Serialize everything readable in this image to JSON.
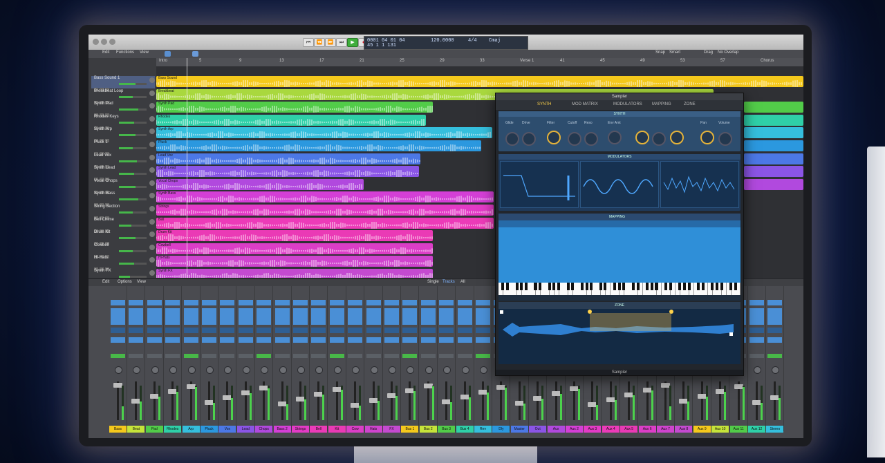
{
  "app": {
    "window_title": "Sampler",
    "plugin_footer": "Sampler"
  },
  "toolbar": {
    "transport": [
      "⏮",
      "⏪",
      "⏩",
      "⏭",
      "▶",
      "●",
      "⟲"
    ],
    "lcd": {
      "position": "0001 04 01 04",
      "bar_beat": "45  1  1  131",
      "tempo": "120.0000",
      "time_sig": "4/4",
      "key": "Cmaj"
    }
  },
  "controlbar": {
    "items": [
      "Edit",
      "Functions",
      "View"
    ],
    "right_items": [
      "Snap",
      "Smart",
      "Drag",
      "No Overlap"
    ]
  },
  "ruler": {
    "marks": [
      "Intro",
      "5",
      "9",
      "13",
      "17",
      "21",
      "25",
      "29",
      "33",
      "Verse 1",
      "41",
      "45",
      "49",
      "53",
      "57",
      "Chorus"
    ]
  },
  "tracks": [
    {
      "name": "Bass Sound 1",
      "color": "#ffd21f",
      "level": 0.6
    },
    {
      "name": "Breakbeat Loop",
      "color": "#c6e43a",
      "level": 0.5
    },
    {
      "name": "Synth Pad",
      "color": "#5ad04a",
      "level": 0.7
    },
    {
      "name": "Rhodes Keys",
      "color": "#2fd9b3",
      "level": 0.55
    },
    {
      "name": "Synth Arp",
      "color": "#35c3df",
      "level": 0.6
    },
    {
      "name": "Pluck 1",
      "color": "#2b9be0",
      "level": 0.5
    },
    {
      "name": "Lead Vox",
      "color": "#4a7de8",
      "level": 0.65
    },
    {
      "name": "Synth Lead",
      "color": "#8a56e8",
      "level": 0.55
    },
    {
      "name": "Vocal Chops",
      "color": "#b34be0",
      "level": 0.6
    },
    {
      "name": "Synth Bass",
      "color": "#d640d6",
      "level": 0.7
    },
    {
      "name": "String Section",
      "color": "#e53cc8",
      "level": 0.5
    },
    {
      "name": "Bell Chime",
      "color": "#ee3cb8",
      "level": 0.45
    },
    {
      "name": "Drum Kit",
      "color": "#ee3cb8",
      "level": 0.6
    },
    {
      "name": "Cowbell",
      "color": "#dd3fc9",
      "level": 0.5
    },
    {
      "name": "Hi-Hats",
      "color": "#d045cf",
      "level": 0.55
    },
    {
      "name": "Synth FX",
      "color": "#c64bd0",
      "level": 0.4
    }
  ],
  "regions": [
    {
      "track": 0,
      "name": "Bass Sound",
      "color": "#f5c91c"
    },
    {
      "track": 1,
      "name": "Breakbeat",
      "color": "#a9d83e"
    },
    {
      "track": 2,
      "name": "Synth Pad",
      "color": "#52cc49"
    },
    {
      "track": 3,
      "name": "Rhodes",
      "color": "#2fd0a8"
    },
    {
      "track": 4,
      "name": "Synth Arp",
      "color": "#35bfdd"
    },
    {
      "track": 5,
      "name": "Pluck",
      "color": "#2b98df"
    },
    {
      "track": 6,
      "name": "Lead Vox",
      "color": "#4c78e6"
    },
    {
      "track": 7,
      "name": "Synth Lead",
      "color": "#8b55e6"
    },
    {
      "track": 8,
      "name": "Vocal Chops",
      "color": "#b149de"
    },
    {
      "track": 9,
      "name": "Synth Bass",
      "color": "#d43fd6"
    },
    {
      "track": 10,
      "name": "Strings",
      "color": "#e33bc6"
    },
    {
      "track": 11,
      "name": "Bell",
      "color": "#ec3bb8"
    },
    {
      "track": 12,
      "name": "Drum Kit",
      "color": "#ea3ab5"
    },
    {
      "track": 13,
      "name": "Cowbell",
      "color": "#dc3ec7"
    },
    {
      "track": 14,
      "name": "Hi-Hats",
      "color": "#cf44ce"
    },
    {
      "track": 15,
      "name": "Synth FX",
      "color": "#c44ad0"
    }
  ],
  "mixer": {
    "bar": [
      "Edit",
      "Options",
      "View",
      "Single",
      "Tracks",
      "All"
    ],
    "channels": [
      "Bass",
      "Beat",
      "Pad",
      "Rhodes",
      "Arp",
      "Pluck",
      "Vox",
      "Lead",
      "Chops",
      "Bass 2",
      "Strings",
      "Bell",
      "Kit",
      "Cow",
      "Hats",
      "FX",
      "Bus 1",
      "Bus 2",
      "Bus 3",
      "Bus 4",
      "Rev",
      "Dly",
      "Master",
      "Out",
      "Aux",
      "Aux 2",
      "Aux 3",
      "Aux 4",
      "Aux 5",
      "Aux 6",
      "Aux 7",
      "Aux 8",
      "Aux 9",
      "Aux 10",
      "Aux 11",
      "Aux 12",
      "Stereo",
      "Main"
    ],
    "channel_colors": [
      "#f5c91c",
      "#c6e43a",
      "#52cc49",
      "#2fd0a8",
      "#35bfdd",
      "#2b98df",
      "#4c78e6",
      "#8b55e6",
      "#b149de",
      "#d43fd6",
      "#e33bc6",
      "#ec3bb8",
      "#ea3ab5",
      "#dc3ec7",
      "#cf44ce",
      "#c44ad0",
      "#f5c91c",
      "#c6e43a",
      "#52cc49",
      "#2fd0a8",
      "#35bfdd",
      "#2b98df",
      "#4c78e6",
      "#8b55e6",
      "#b149de",
      "#d43fd6",
      "#e33bc6",
      "#ec3bb8",
      "#ea3ab5",
      "#dc3ec7",
      "#cf44ce",
      "#c44ad0",
      "#f5c91c",
      "#c6e43a",
      "#52cc49",
      "#2fd0a8",
      "#35bfdd",
      "#2b98df"
    ]
  },
  "sampler": {
    "nav": [
      "SYNTH",
      "MOD MATRIX",
      "MODULATORS",
      "MAPPING",
      "ZONE"
    ],
    "synth_header": "SYNTH",
    "mod_header": "MODULATORS",
    "map_header": "MAPPING",
    "zone_header": "ZONE",
    "labels": [
      "Glide",
      "Drive",
      "Filter",
      "Cutoff",
      "Reso",
      "Env Amt",
      "Pan",
      "Volume"
    ]
  }
}
